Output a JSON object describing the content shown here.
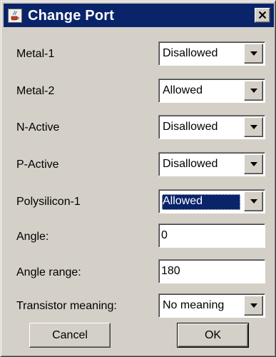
{
  "window": {
    "title": "Change Port",
    "icon": "java-cup-icon",
    "close_icon": "close-icon"
  },
  "fields": [
    {
      "label": "Metal-1",
      "type": "select",
      "value": "Disallowed",
      "focused": false
    },
    {
      "label": "Metal-2",
      "type": "select",
      "value": "Allowed",
      "focused": false
    },
    {
      "label": "N-Active",
      "type": "select",
      "value": "Disallowed",
      "focused": false
    },
    {
      "label": "P-Active",
      "type": "select",
      "value": "Disallowed",
      "focused": false
    },
    {
      "label": "Polysilicon-1",
      "type": "select",
      "value": "Allowed",
      "focused": true
    },
    {
      "label": "Angle:",
      "type": "text",
      "value": "0"
    },
    {
      "label": "Angle range:",
      "type": "text",
      "value": "180"
    },
    {
      "label": "Transistor meaning:",
      "type": "select",
      "value": "No meaning",
      "focused": false
    }
  ],
  "buttons": {
    "cancel_label": "Cancel",
    "ok_label": "OK"
  },
  "colors": {
    "titlebar": "#0a246a",
    "dialog_face": "#d4d0c8",
    "selection": "#0a246a"
  }
}
